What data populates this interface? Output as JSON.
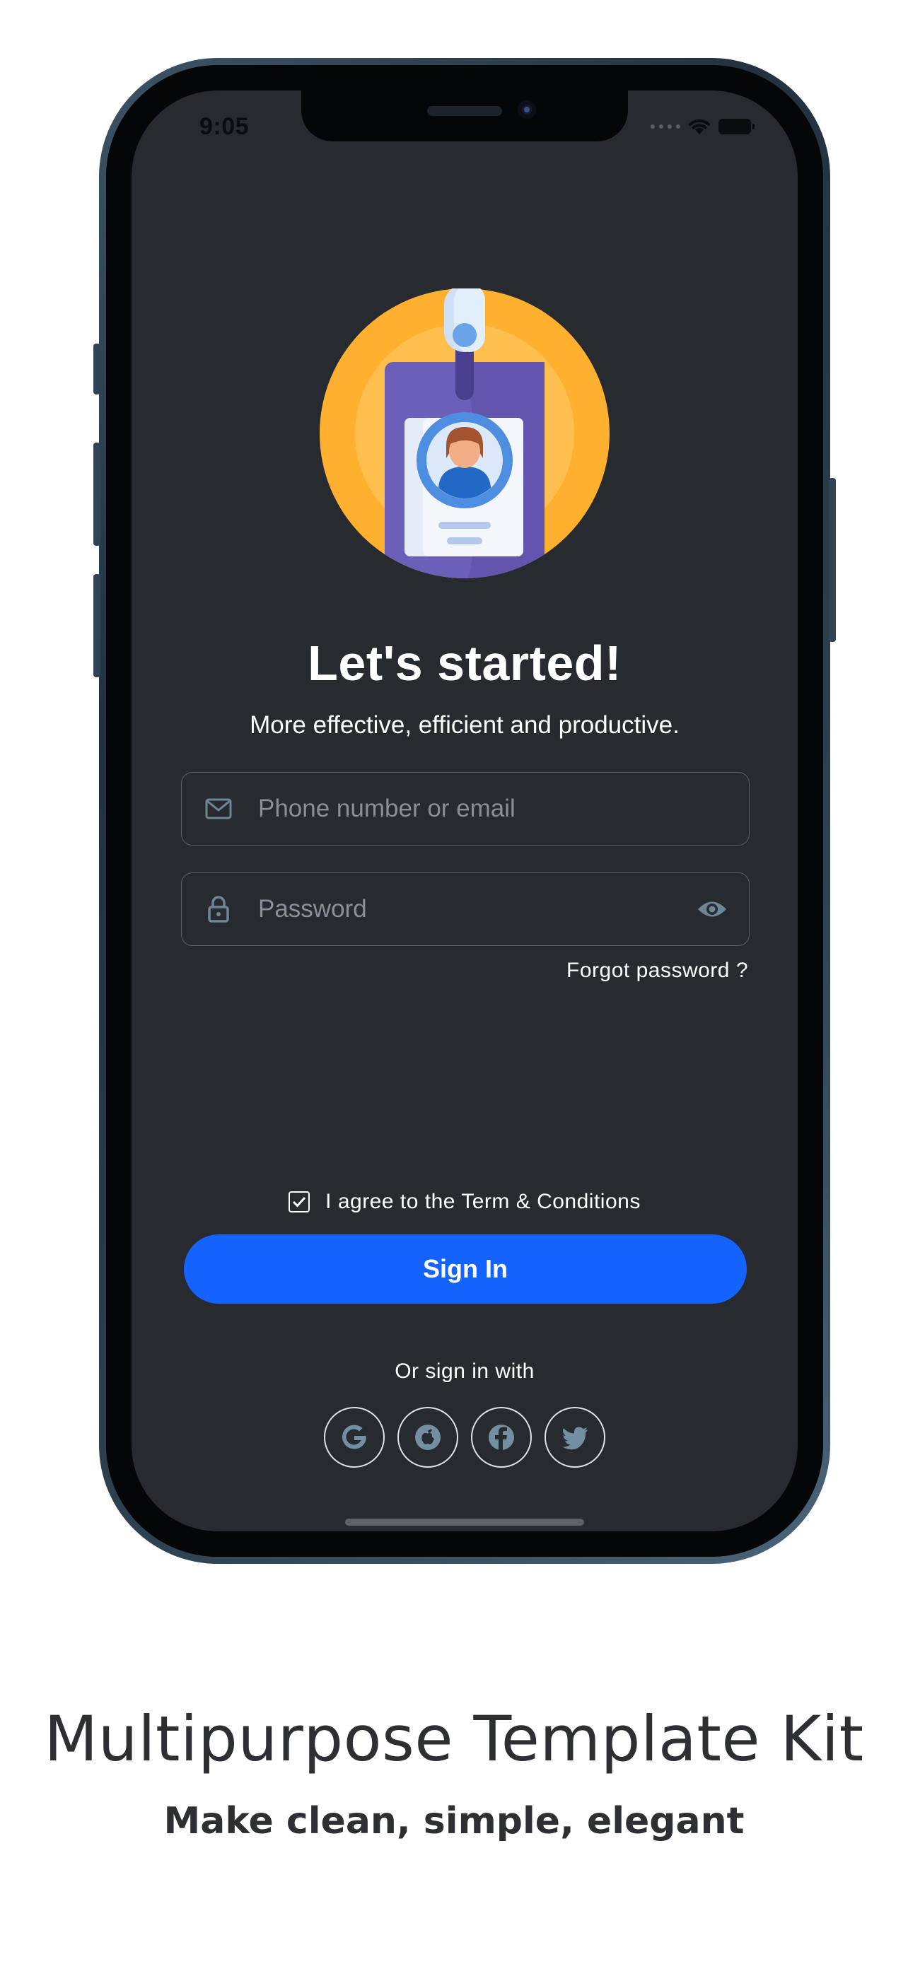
{
  "status_bar": {
    "time": "9:05"
  },
  "main": {
    "title": "Let's started!",
    "subtitle": "More effective, efficient and productive.",
    "email_field": {
      "placeholder": "Phone number or email",
      "value": ""
    },
    "password_field": {
      "placeholder": "Password",
      "value": ""
    },
    "forgot_password": "Forgot password ?",
    "agree": {
      "label": "I agree to the Term & Conditions",
      "checked": true
    },
    "sign_in_label": "Sign In",
    "or_sign_in_with": "Or sign in with",
    "social_buttons": [
      "google-icon",
      "apple-icon",
      "facebook-icon",
      "twitter-icon"
    ]
  },
  "footer": {
    "title": "Multipurpose Template Kit",
    "subtitle": "Make clean, simple, elegant"
  },
  "colors": {
    "screen_bg": "#272a2f",
    "accent": "#1563ff",
    "illustration_circle": "#ffb02e",
    "badge": "#6c5fba"
  }
}
